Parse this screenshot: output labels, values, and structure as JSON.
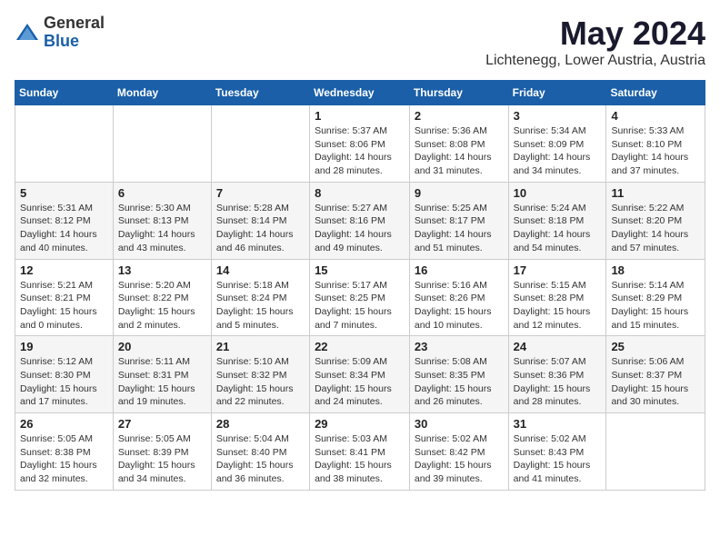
{
  "logo": {
    "general": "General",
    "blue": "Blue"
  },
  "title": "May 2024",
  "location": "Lichtenegg, Lower Austria, Austria",
  "weekdays": [
    "Sunday",
    "Monday",
    "Tuesday",
    "Wednesday",
    "Thursday",
    "Friday",
    "Saturday"
  ],
  "weeks": [
    [
      null,
      null,
      null,
      {
        "day": 1,
        "sunrise": "5:37 AM",
        "sunset": "8:06 PM",
        "daylight": "14 hours and 28 minutes."
      },
      {
        "day": 2,
        "sunrise": "5:36 AM",
        "sunset": "8:08 PM",
        "daylight": "14 hours and 31 minutes."
      },
      {
        "day": 3,
        "sunrise": "5:34 AM",
        "sunset": "8:09 PM",
        "daylight": "14 hours and 34 minutes."
      },
      {
        "day": 4,
        "sunrise": "5:33 AM",
        "sunset": "8:10 PM",
        "daylight": "14 hours and 37 minutes."
      }
    ],
    [
      {
        "day": 5,
        "sunrise": "5:31 AM",
        "sunset": "8:12 PM",
        "daylight": "14 hours and 40 minutes."
      },
      {
        "day": 6,
        "sunrise": "5:30 AM",
        "sunset": "8:13 PM",
        "daylight": "14 hours and 43 minutes."
      },
      {
        "day": 7,
        "sunrise": "5:28 AM",
        "sunset": "8:14 PM",
        "daylight": "14 hours and 46 minutes."
      },
      {
        "day": 8,
        "sunrise": "5:27 AM",
        "sunset": "8:16 PM",
        "daylight": "14 hours and 49 minutes."
      },
      {
        "day": 9,
        "sunrise": "5:25 AM",
        "sunset": "8:17 PM",
        "daylight": "14 hours and 51 minutes."
      },
      {
        "day": 10,
        "sunrise": "5:24 AM",
        "sunset": "8:18 PM",
        "daylight": "14 hours and 54 minutes."
      },
      {
        "day": 11,
        "sunrise": "5:22 AM",
        "sunset": "8:20 PM",
        "daylight": "14 hours and 57 minutes."
      }
    ],
    [
      {
        "day": 12,
        "sunrise": "5:21 AM",
        "sunset": "8:21 PM",
        "daylight": "15 hours and 0 minutes."
      },
      {
        "day": 13,
        "sunrise": "5:20 AM",
        "sunset": "8:22 PM",
        "daylight": "15 hours and 2 minutes."
      },
      {
        "day": 14,
        "sunrise": "5:18 AM",
        "sunset": "8:24 PM",
        "daylight": "15 hours and 5 minutes."
      },
      {
        "day": 15,
        "sunrise": "5:17 AM",
        "sunset": "8:25 PM",
        "daylight": "15 hours and 7 minutes."
      },
      {
        "day": 16,
        "sunrise": "5:16 AM",
        "sunset": "8:26 PM",
        "daylight": "15 hours and 10 minutes."
      },
      {
        "day": 17,
        "sunrise": "5:15 AM",
        "sunset": "8:28 PM",
        "daylight": "15 hours and 12 minutes."
      },
      {
        "day": 18,
        "sunrise": "5:14 AM",
        "sunset": "8:29 PM",
        "daylight": "15 hours and 15 minutes."
      }
    ],
    [
      {
        "day": 19,
        "sunrise": "5:12 AM",
        "sunset": "8:30 PM",
        "daylight": "15 hours and 17 minutes."
      },
      {
        "day": 20,
        "sunrise": "5:11 AM",
        "sunset": "8:31 PM",
        "daylight": "15 hours and 19 minutes."
      },
      {
        "day": 21,
        "sunrise": "5:10 AM",
        "sunset": "8:32 PM",
        "daylight": "15 hours and 22 minutes."
      },
      {
        "day": 22,
        "sunrise": "5:09 AM",
        "sunset": "8:34 PM",
        "daylight": "15 hours and 24 minutes."
      },
      {
        "day": 23,
        "sunrise": "5:08 AM",
        "sunset": "8:35 PM",
        "daylight": "15 hours and 26 minutes."
      },
      {
        "day": 24,
        "sunrise": "5:07 AM",
        "sunset": "8:36 PM",
        "daylight": "15 hours and 28 minutes."
      },
      {
        "day": 25,
        "sunrise": "5:06 AM",
        "sunset": "8:37 PM",
        "daylight": "15 hours and 30 minutes."
      }
    ],
    [
      {
        "day": 26,
        "sunrise": "5:05 AM",
        "sunset": "8:38 PM",
        "daylight": "15 hours and 32 minutes."
      },
      {
        "day": 27,
        "sunrise": "5:05 AM",
        "sunset": "8:39 PM",
        "daylight": "15 hours and 34 minutes."
      },
      {
        "day": 28,
        "sunrise": "5:04 AM",
        "sunset": "8:40 PM",
        "daylight": "15 hours and 36 minutes."
      },
      {
        "day": 29,
        "sunrise": "5:03 AM",
        "sunset": "8:41 PM",
        "daylight": "15 hours and 38 minutes."
      },
      {
        "day": 30,
        "sunrise": "5:02 AM",
        "sunset": "8:42 PM",
        "daylight": "15 hours and 39 minutes."
      },
      {
        "day": 31,
        "sunrise": "5:02 AM",
        "sunset": "8:43 PM",
        "daylight": "15 hours and 41 minutes."
      },
      null
    ]
  ]
}
